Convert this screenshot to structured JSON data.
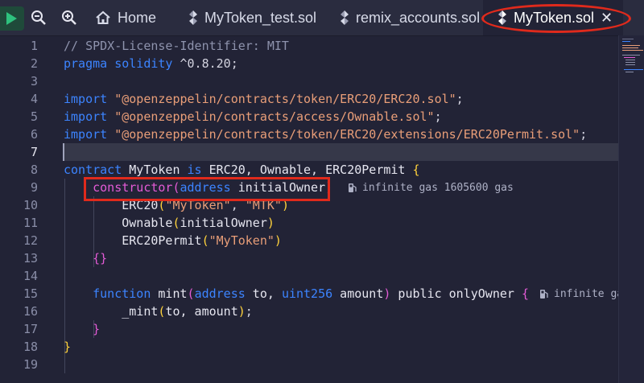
{
  "tabs": [
    {
      "label": "Home",
      "icon": "home-icon"
    },
    {
      "label": "MyToken_test.sol",
      "icon": "solidity-file-icon"
    },
    {
      "label": "remix_accounts.sol",
      "icon": "solidity-file-icon"
    },
    {
      "label": "MyToken.sol",
      "icon": "solidity-file-icon",
      "active": true
    }
  ],
  "toolbar": {
    "run_icon": "play-icon",
    "zoom_out_icon": "zoom-out-icon",
    "zoom_in_icon": "zoom-in-icon",
    "close_icon": "close-icon"
  },
  "editor": {
    "current_line": 7,
    "line_numbers": [
      "1",
      "2",
      "3",
      "4",
      "5",
      "6",
      "7",
      "8",
      "9",
      "10",
      "11",
      "12",
      "13",
      "14",
      "15",
      "16",
      "17",
      "18",
      "19"
    ],
    "lines": [
      {
        "tokens": [
          {
            "t": "// SPDX-License-Identifier: MIT",
            "c": "c-com"
          }
        ]
      },
      {
        "tokens": [
          {
            "t": "pragma",
            "c": "c-kw"
          },
          {
            "t": " ",
            "c": "c-pun"
          },
          {
            "t": "solidity",
            "c": "c-kw"
          },
          {
            "t": " ^0.8.20;",
            "c": "c-pun"
          }
        ]
      },
      {
        "tokens": []
      },
      {
        "tokens": [
          {
            "t": "import",
            "c": "c-kw"
          },
          {
            "t": " ",
            "c": "c-pun"
          },
          {
            "t": "\"@openzeppelin/contracts/token/ERC20/ERC20.sol\"",
            "c": "c-str"
          },
          {
            "t": ";",
            "c": "c-pun"
          }
        ]
      },
      {
        "tokens": [
          {
            "t": "import",
            "c": "c-kw"
          },
          {
            "t": " ",
            "c": "c-pun"
          },
          {
            "t": "\"@openzeppelin/contracts/access/Ownable.sol\"",
            "c": "c-str"
          },
          {
            "t": ";",
            "c": "c-pun"
          }
        ]
      },
      {
        "tokens": [
          {
            "t": "import",
            "c": "c-kw"
          },
          {
            "t": " ",
            "c": "c-pun"
          },
          {
            "t": "\"@openzeppelin/contracts/token/ERC20/extensions/ERC20Permit.sol\"",
            "c": "c-str"
          },
          {
            "t": ";",
            "c": "c-pun"
          }
        ]
      },
      {
        "tokens": []
      },
      {
        "tokens": [
          {
            "t": "contract",
            "c": "c-kw"
          },
          {
            "t": " MyToken ",
            "c": "c-fn"
          },
          {
            "t": "is",
            "c": "c-kw"
          },
          {
            "t": " ERC20, Ownable, ERC20Permit ",
            "c": "c-fn"
          },
          {
            "t": "{",
            "c": "c-br"
          }
        ]
      },
      {
        "tokens": [
          {
            "t": "    constructor",
            "c": "c-pr"
          },
          {
            "t": "(",
            "c": "c-br2"
          },
          {
            "t": "address",
            "c": "c-kw"
          },
          {
            "t": " initialOwner",
            "c": "c-fn"
          },
          {
            "t": ")",
            "c": "c-br2"
          }
        ]
      },
      {
        "tokens": [
          {
            "t": "        ERC20",
            "c": "c-fn"
          },
          {
            "t": "(",
            "c": "c-br"
          },
          {
            "t": "\"MyToken\"",
            "c": "c-str"
          },
          {
            "t": ", ",
            "c": "c-pun"
          },
          {
            "t": "\"MTK\"",
            "c": "c-str"
          },
          {
            "t": ")",
            "c": "c-br"
          }
        ]
      },
      {
        "tokens": [
          {
            "t": "        Ownable",
            "c": "c-fn"
          },
          {
            "t": "(",
            "c": "c-br"
          },
          {
            "t": "initialOwner",
            "c": "c-fn"
          },
          {
            "t": ")",
            "c": "c-br"
          }
        ]
      },
      {
        "tokens": [
          {
            "t": "        ERC20Permit",
            "c": "c-fn"
          },
          {
            "t": "(",
            "c": "c-br"
          },
          {
            "t": "\"MyToken\"",
            "c": "c-str"
          },
          {
            "t": ")",
            "c": "c-br"
          }
        ]
      },
      {
        "tokens": [
          {
            "t": "    {}",
            "c": "c-pr"
          }
        ]
      },
      {
        "tokens": []
      },
      {
        "tokens": [
          {
            "t": "    function",
            "c": "c-kw"
          },
          {
            "t": " mint",
            "c": "c-fn"
          },
          {
            "t": "(",
            "c": "c-pr"
          },
          {
            "t": "address",
            "c": "c-kw"
          },
          {
            "t": " to, ",
            "c": "c-fn"
          },
          {
            "t": "uint256",
            "c": "c-kw"
          },
          {
            "t": " amount",
            "c": "c-fn"
          },
          {
            "t": ")",
            "c": "c-pr"
          },
          {
            "t": " public onlyOwner ",
            "c": "c-fn"
          },
          {
            "t": "{",
            "c": "c-pr"
          }
        ]
      },
      {
        "tokens": [
          {
            "t": "        _mint",
            "c": "c-fn"
          },
          {
            "t": "(",
            "c": "c-br"
          },
          {
            "t": "to, amount",
            "c": "c-fn"
          },
          {
            "t": ")",
            "c": "c-br"
          },
          {
            "t": ";",
            "c": "c-pun"
          }
        ]
      },
      {
        "tokens": [
          {
            "t": "    }",
            "c": "c-pr"
          }
        ]
      },
      {
        "tokens": [
          {
            "t": "}",
            "c": "c-br"
          }
        ]
      },
      {
        "tokens": []
      }
    ],
    "gas_hints": [
      {
        "line": 9,
        "text": "infinite gas 1605600 gas",
        "icon": "gas-pump-icon"
      },
      {
        "line": 15,
        "text": "infinite ga",
        "icon": "gas-pump-icon"
      }
    ]
  },
  "colors": {
    "annotation": "#e02a1c",
    "editor_bg": "#222336",
    "keyword": "#3c84ff",
    "string": "#e99e78"
  }
}
